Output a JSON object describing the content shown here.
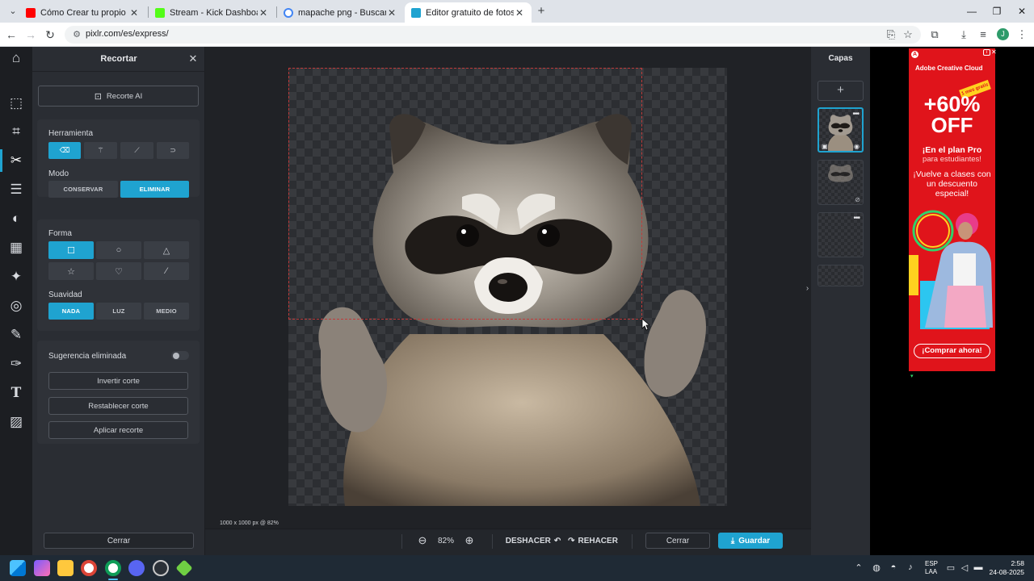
{
  "browser": {
    "tabs": [
      {
        "title": "Cómo Crear tu propio Vtuber e",
        "favicon_color": "#ff0000",
        "active": false
      },
      {
        "title": "Stream - Kick Dashboard",
        "favicon_color": "#53fc18",
        "active": false
      },
      {
        "title": "mapache png - Buscar con Goo",
        "favicon_color": "#4285f4",
        "active": false
      },
      {
        "title": "Editor gratuito de fotos con IA",
        "favicon_color": "#1fa3d0",
        "active": true
      }
    ],
    "url": "pixlr.com/es/express/",
    "profile_initial": "J"
  },
  "editor": {
    "panel": {
      "title": "Recortar",
      "ai_button": "Recorte AI",
      "tool_label": "Herramienta",
      "tools": [
        "eraser-icon",
        "magic-wand-icon",
        "brush-icon",
        "lasso-icon"
      ],
      "mode_label": "Modo",
      "modes": [
        {
          "label": "CONSERVAR",
          "on": false
        },
        {
          "label": "ELIMINAR",
          "on": true
        }
      ],
      "shape_label": "Forma",
      "shapes": [
        "square-icon",
        "circle-icon",
        "triangle-icon",
        "star-icon",
        "heart-icon",
        "line-icon"
      ],
      "smooth_label": "Suavidad",
      "smooth": [
        {
          "label": "NADA",
          "on": true
        },
        {
          "label": "LUZ",
          "on": false
        },
        {
          "label": "MEDIO",
          "on": false
        }
      ],
      "suggestion_label": "Sugerencia eliminada",
      "invert": "Invertir corte",
      "reset": "Restablecer corte",
      "apply": "Aplicar recorte",
      "close": "Cerrar"
    },
    "layers_title": "Capas",
    "canvas_info": "1000 x 1000 px @ 82%",
    "zoom": "82%",
    "undo": "DESHACER",
    "redo": "REHACER",
    "close_button": "Cerrar",
    "save_button": "Guardar",
    "accent": "#1fa3d0"
  },
  "ad": {
    "brand": "Adobe Creative Cloud",
    "ribbon": "1 mes gratis",
    "headline1": "+60%",
    "headline2": "OFF",
    "line1": "¡En el plan Pro",
    "line2": "para estudiantes!",
    "line3": "¡Vuelve a clases con un descuento especial!",
    "cta": "¡Comprar ahora!"
  },
  "taskbar": {
    "lang1": "ESP",
    "lang2": "LAA",
    "time": "2:58",
    "date": "24-08-2025"
  }
}
